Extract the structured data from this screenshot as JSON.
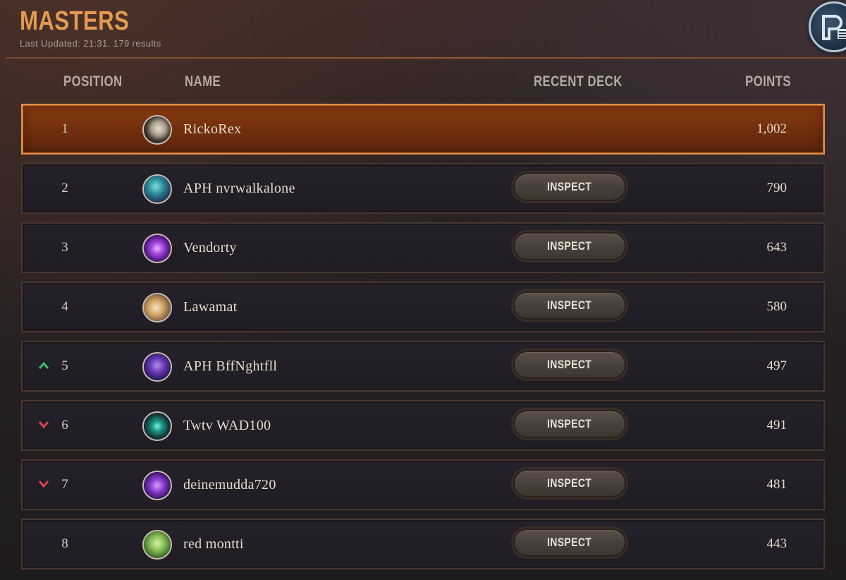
{
  "header": {
    "title": "MASTERS",
    "subtitle": "Last Updated: 21:31. 179 results"
  },
  "columns": {
    "position": "POSITION",
    "name": "NAME",
    "recent_deck": "RECENT DECK",
    "points": "POINTS"
  },
  "inspect_label": "INSPECT",
  "colors": {
    "accent": "#e39a52",
    "trend_up": "#3fbf6a",
    "trend_down": "#d9454f",
    "top_row": "#7a3410"
  },
  "rows": [
    {
      "position": "1",
      "name": "RickoRex",
      "points": "1,002",
      "trend": "none",
      "avatar": "dragon-avatar",
      "has_deck": false
    },
    {
      "position": "2",
      "name": "APH nvrwalkalone",
      "points": "790",
      "trend": "none",
      "avatar": "teal-champion-avatar",
      "has_deck": true
    },
    {
      "position": "3",
      "name": "Vendorty",
      "points": "643",
      "trend": "none",
      "avatar": "purple-emblem-avatar",
      "has_deck": true
    },
    {
      "position": "4",
      "name": "Lawamat",
      "points": "580",
      "trend": "none",
      "avatar": "poro-avatar",
      "has_deck": true
    },
    {
      "position": "5",
      "name": "APH BffNghtfll",
      "points": "497",
      "trend": "up",
      "avatar": "purple-dragon-avatar",
      "has_deck": true
    },
    {
      "position": "6",
      "name": "Twtv WAD100",
      "points": "491",
      "trend": "down",
      "avatar": "teal-spirit-avatar",
      "has_deck": true
    },
    {
      "position": "7",
      "name": "deinemudda720",
      "points": "481",
      "trend": "down",
      "avatar": "purple-mask-avatar",
      "has_deck": true
    },
    {
      "position": "8",
      "name": "red montti",
      "points": "443",
      "trend": "none",
      "avatar": "green-creature-avatar",
      "has_deck": true
    }
  ]
}
